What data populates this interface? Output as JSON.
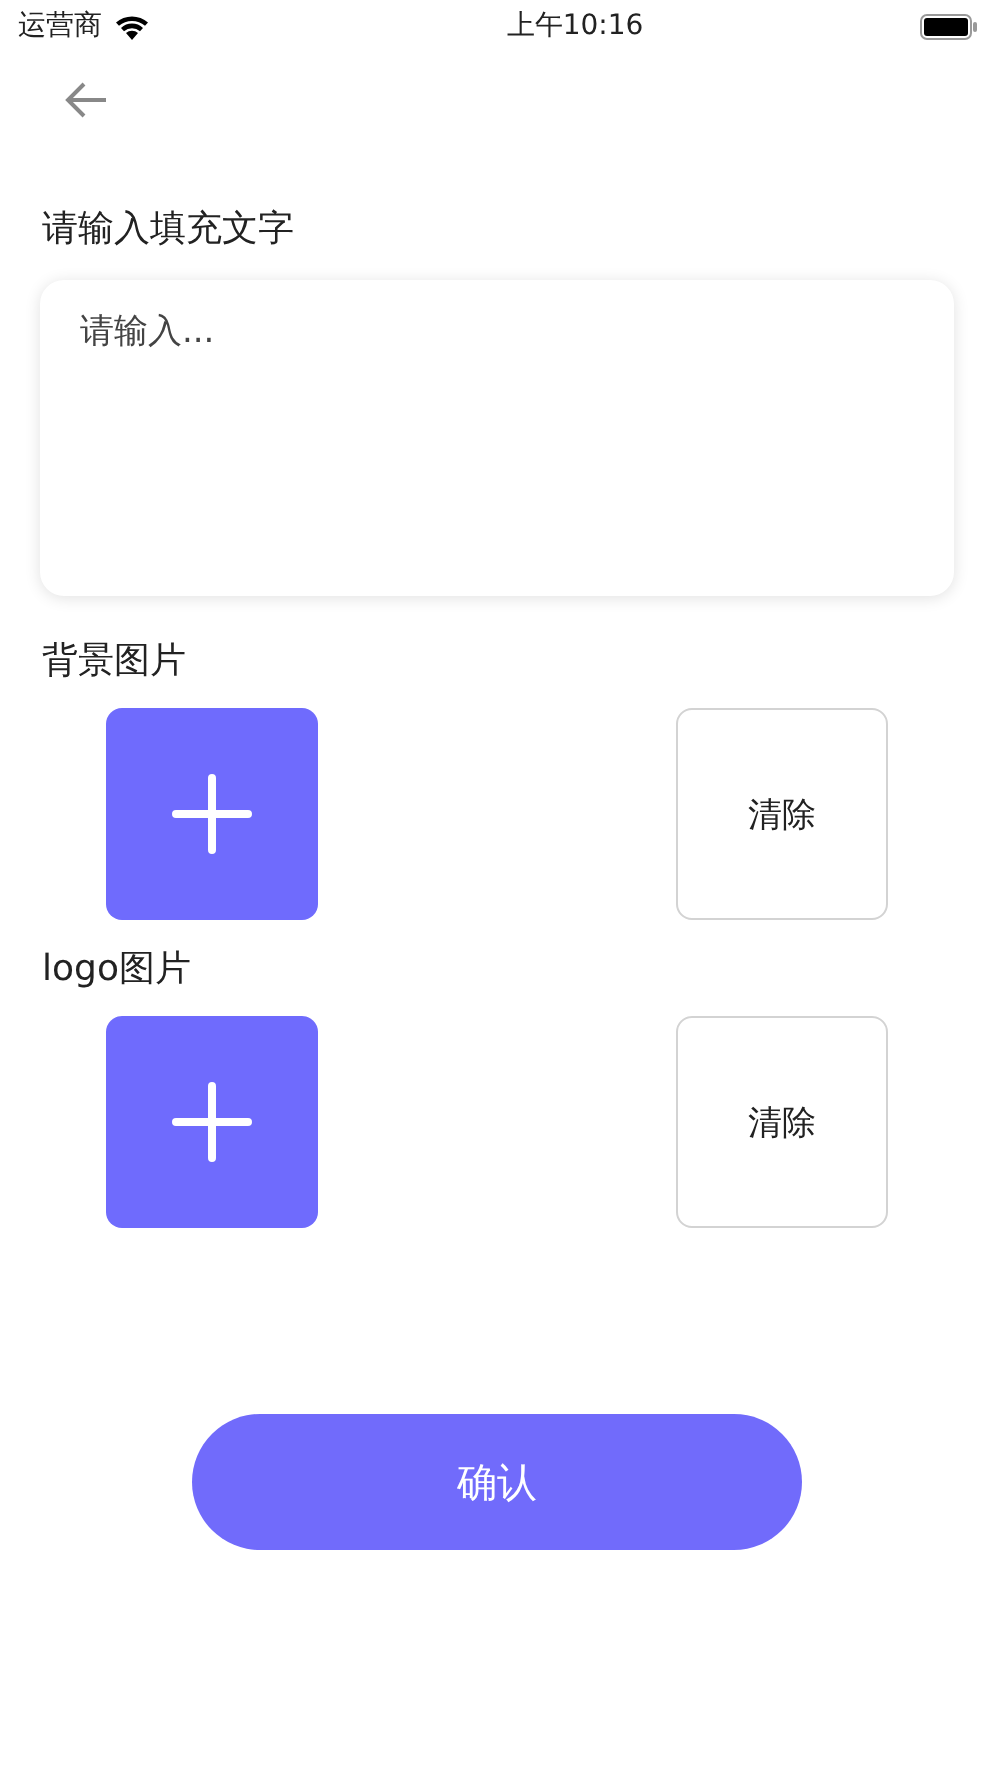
{
  "status_bar": {
    "carrier": "运营商",
    "time": "上午10:16"
  },
  "text_input": {
    "label": "请输入填充文字",
    "placeholder": "请输入..."
  },
  "image_sections": [
    {
      "label": "背景图片",
      "clear_button": "清除"
    },
    {
      "label": "logo图片",
      "clear_button": "清除"
    }
  ],
  "confirm_button": "确认"
}
